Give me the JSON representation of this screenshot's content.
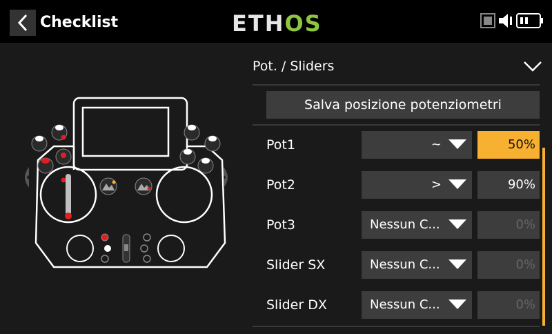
{
  "header": {
    "title": "Checklist",
    "logo_left": "ETH",
    "logo_right": "OS"
  },
  "section": {
    "title": "Pot. / Sliders",
    "save_button": "Salva posizione potenziometri"
  },
  "rows": [
    {
      "label": "Pot1",
      "condition": "~",
      "value": "50%",
      "state": "active"
    },
    {
      "label": "Pot2",
      "condition": ">",
      "value": "90%",
      "state": "normal"
    },
    {
      "label": "Pot3",
      "condition": "Nessun C...",
      "value": "0%",
      "state": "disabled"
    },
    {
      "label": "Slider SX",
      "condition": "Nessun C...",
      "value": "0%",
      "state": "disabled"
    },
    {
      "label": "Slider DX",
      "condition": "Nessun C...",
      "value": "0%",
      "state": "disabled"
    }
  ],
  "colors": {
    "accent": "#f7b030",
    "logo_green": "#8dc63f",
    "field_bg": "#3d3d3d"
  },
  "icons": [
    "back-arrow-icon",
    "record-icon",
    "speaker-icon",
    "battery-icon",
    "chevron-down-icon",
    "caret-down-icon"
  ]
}
